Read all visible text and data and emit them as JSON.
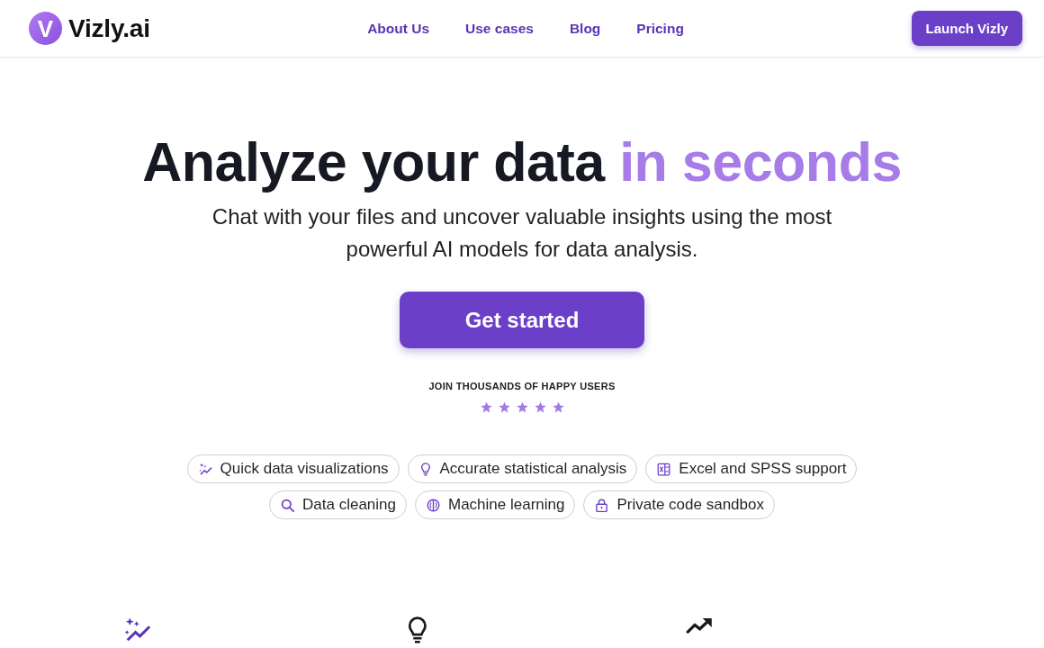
{
  "header": {
    "logo": {
      "mark": "V",
      "name": "Vizly.ai"
    },
    "nav": [
      "About Us",
      "Use cases",
      "Blog",
      "Pricing"
    ],
    "cta": "Launch Vizly"
  },
  "hero": {
    "title": "Analyze your data",
    "title_highlight": "in seconds",
    "subtitle": "Chat with your files and uncover valuable insights using the most powerful AI models for data analysis.",
    "cta": "Get started",
    "social_proof": "JOIN THOUSANDS OF HAPPY USERS",
    "rating": {
      "stars": 5
    }
  },
  "feature_tags": [
    {
      "kind": "sparkles",
      "label": "Quick data visualizations"
    },
    {
      "kind": "bulb",
      "label": "Accurate statistical analysis"
    },
    {
      "kind": "sheet",
      "label": "Excel and SPSS support"
    },
    {
      "kind": "search",
      "label": "Data cleaning"
    },
    {
      "kind": "brain",
      "label": "Machine learning"
    },
    {
      "kind": "lock",
      "label": "Private code sandbox"
    }
  ],
  "feature_cards": [
    {
      "kind": "sparkles",
      "color": "#5b34b5"
    },
    {
      "kind": "bulb",
      "color": "#1a1a1a"
    },
    {
      "kind": "trend",
      "color": "#1a1a1a"
    }
  ]
}
